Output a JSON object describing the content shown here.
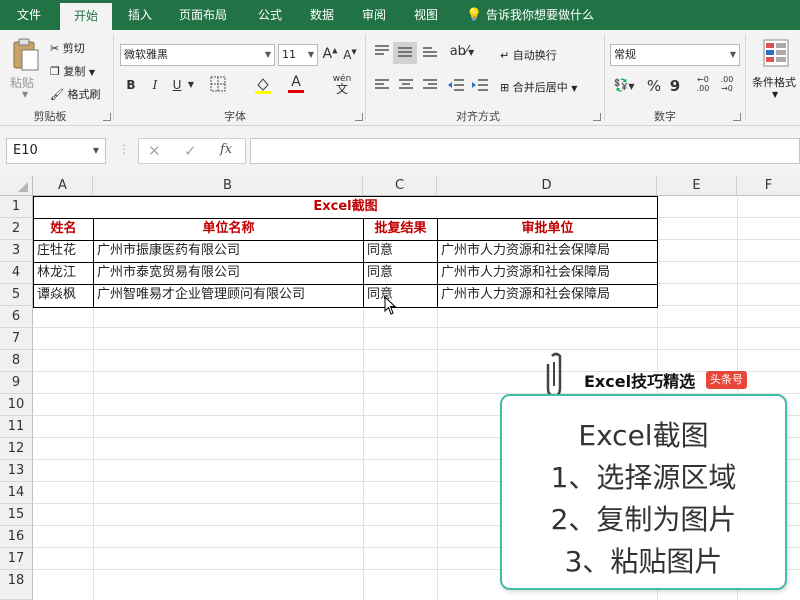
{
  "tabs": [
    "文件",
    "开始",
    "插入",
    "页面布局",
    "公式",
    "数据",
    "审阅",
    "视图"
  ],
  "active_tab": "开始",
  "tell_me": "告诉我你想要做什么",
  "clipboard": {
    "paste": "粘贴",
    "cut": "剪切",
    "copy": "复制",
    "format_painter": "格式刷",
    "label": "剪贴板"
  },
  "font": {
    "name": "微软雅黑",
    "size": "11",
    "bold": "B",
    "italic": "I",
    "underline": "U",
    "wen": "wén",
    "label": "字体"
  },
  "alignment": {
    "wrap_text": "自动换行",
    "merge_center": "合并后居中",
    "label": "对齐方式"
  },
  "number": {
    "format": "常规",
    "percent": "%",
    "comma": "9",
    "label": "数字"
  },
  "styles": {
    "conditional": "条件格式"
  },
  "formula_bar": {
    "name_box": "E10",
    "fx": "fx",
    "formula": ""
  },
  "columns": [
    "A",
    "B",
    "C",
    "D",
    "E",
    "F"
  ],
  "rows": [
    "1",
    "2",
    "3",
    "4",
    "5",
    "6",
    "7",
    "8",
    "9",
    "10",
    "11",
    "12",
    "13",
    "14",
    "15",
    "16",
    "17",
    "18"
  ],
  "sheet": {
    "title": "Excel截图",
    "headers": [
      "姓名",
      "单位名称",
      "批复结果",
      "审批单位"
    ],
    "data": [
      [
        "庄牡花",
        "广州市振康医药有限公司",
        "同意",
        "广州市人力资源和社会保障局"
      ],
      [
        "林龙江",
        "广州市泰宽贸易有限公司",
        "同意",
        "广州市人力资源和社会保障局"
      ],
      [
        "谭焱枫",
        "广州智唯易才企业管理顾问有限公司",
        "同意",
        "广州市人力资源和社会保障局"
      ]
    ]
  },
  "brand": {
    "name": "Excel技巧精选",
    "badge": "头条号",
    "accent": "#3dbfa8",
    "badge_color": "#e8463b"
  },
  "card": {
    "title": "Excel截图",
    "steps": [
      "1、选择源区域",
      "2、复制为图片",
      "3、粘贴图片"
    ]
  },
  "colors": {
    "excel_green": "#217346",
    "header_red": "#c00000"
  }
}
